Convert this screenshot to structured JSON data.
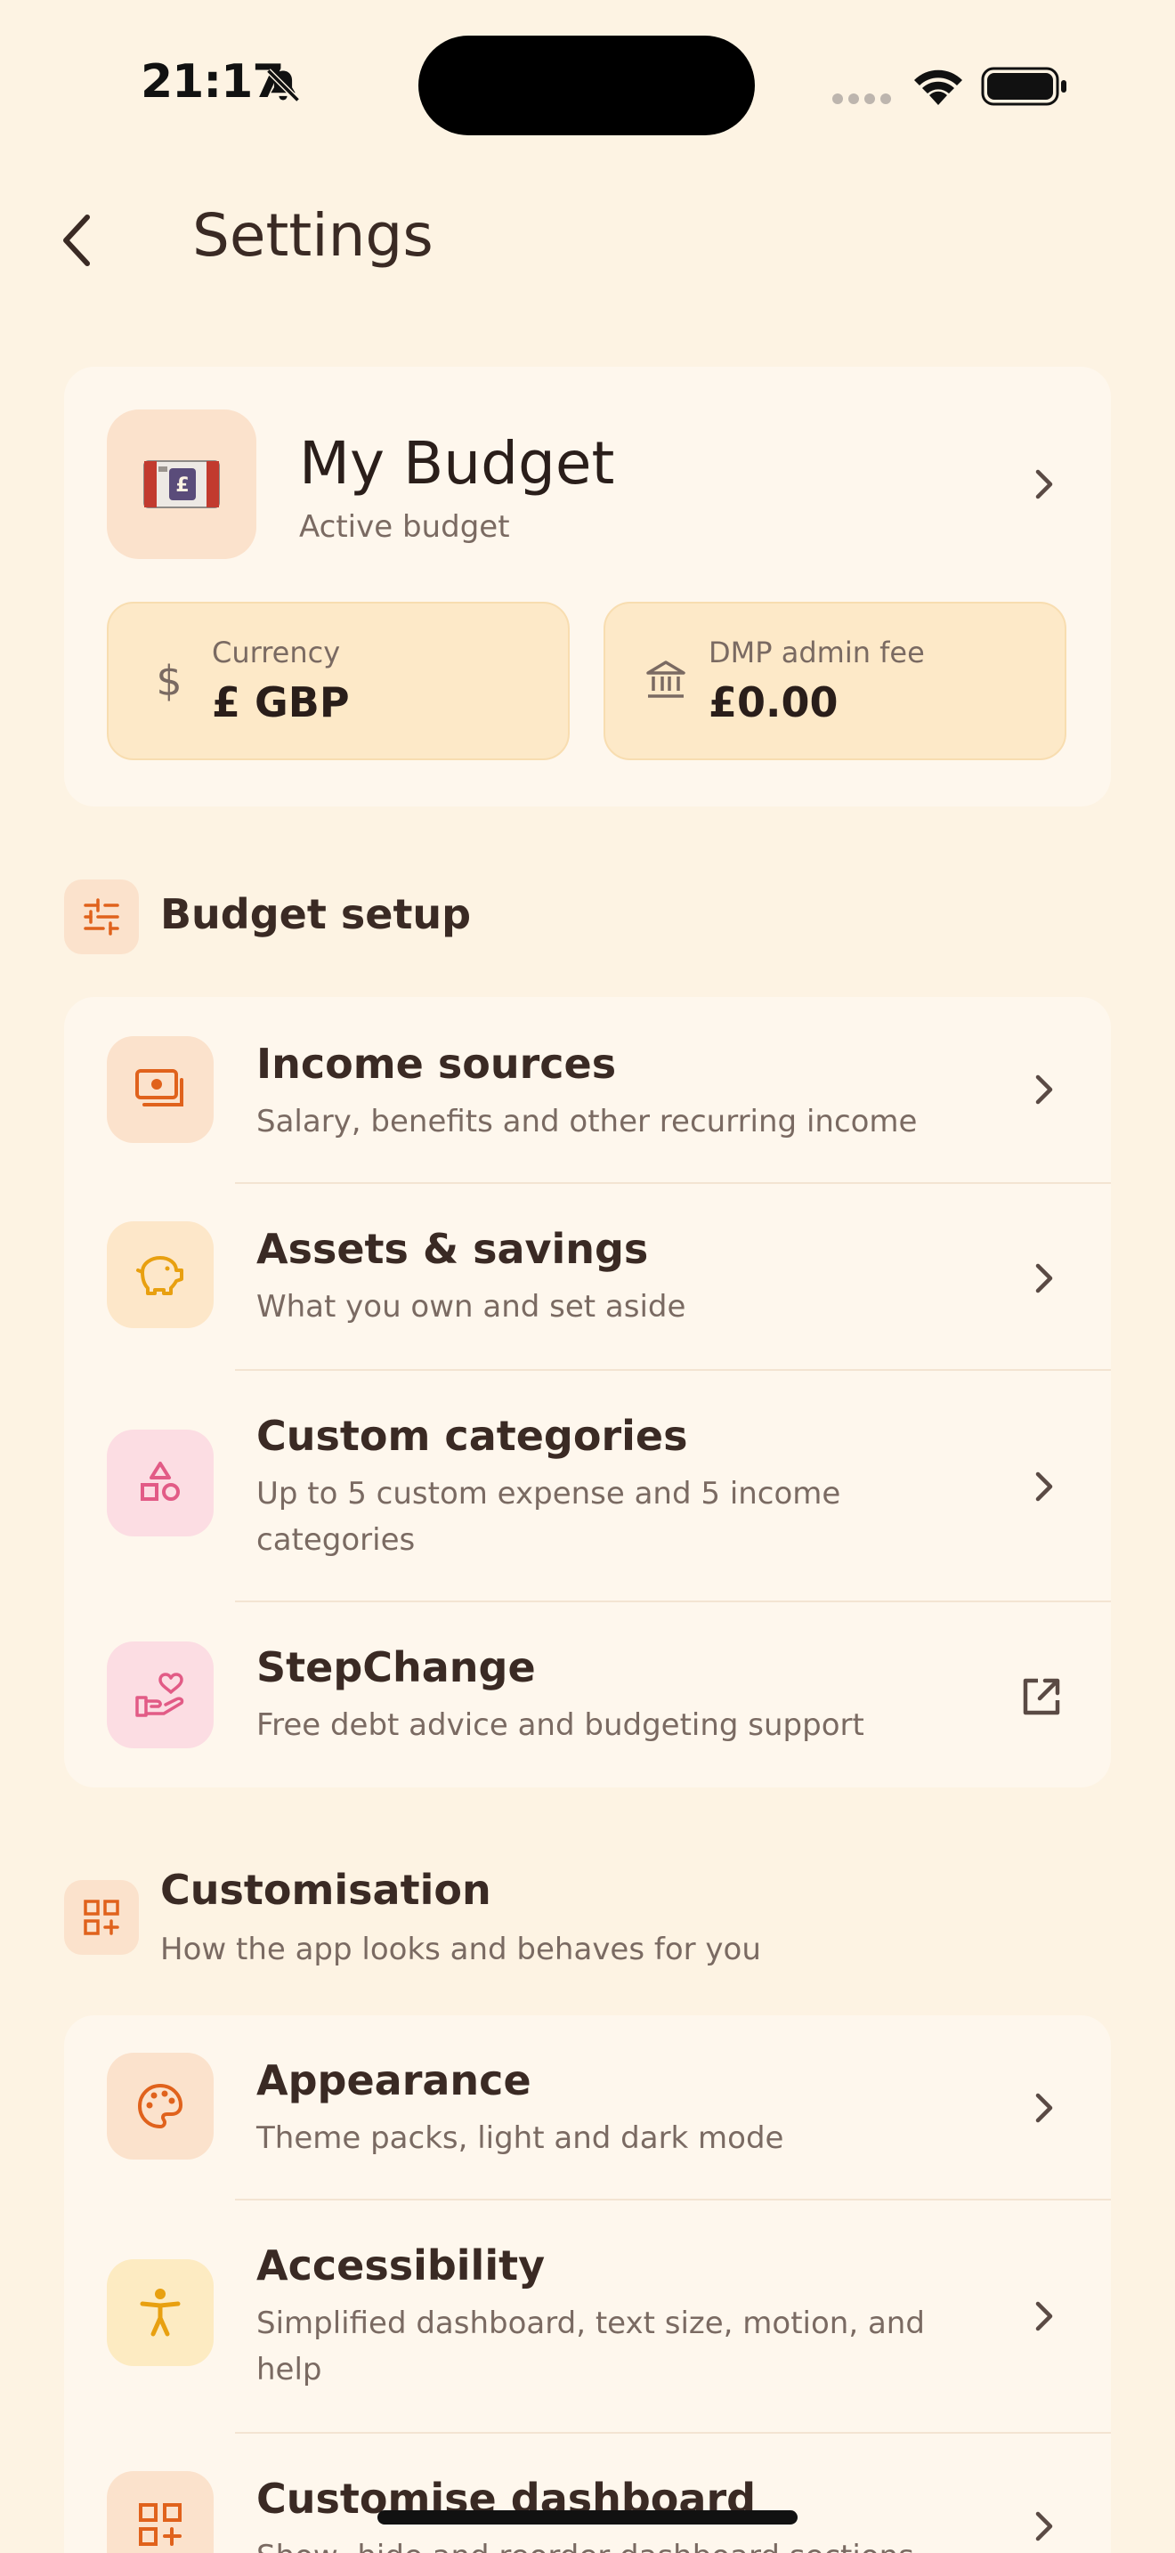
{
  "status_bar": {
    "time": "21:17"
  },
  "header": {
    "title": "Settings"
  },
  "budget": {
    "name": "My Budget",
    "subtitle": "Active budget",
    "currency_label": "Currency",
    "currency_value": "£ GBP",
    "fee_label": "DMP admin fee",
    "fee_value": "£0.00"
  },
  "budget_setup": {
    "title": "Budget setup",
    "items": [
      {
        "title": "Income sources",
        "subtitle": "Salary, benefits and other recurring income"
      },
      {
        "title": "Assets & savings",
        "subtitle": "What you own and set aside"
      },
      {
        "title": "Custom categories",
        "subtitle": "Up to 5 custom expense and 5 income categories"
      },
      {
        "title": "StepChange",
        "subtitle": "Free debt advice and budgeting support"
      }
    ]
  },
  "customisation": {
    "title": "Customisation",
    "subtitle": "How the app looks and behaves for you",
    "items": [
      {
        "title": "Appearance",
        "subtitle": "Theme packs, light and dark mode"
      },
      {
        "title": "Accessibility",
        "subtitle": "Simplified dashboard, text size, motion, and help"
      },
      {
        "title": "Customise dashboard",
        "subtitle": "Show, hide and reorder dashboard sections"
      }
    ]
  },
  "colors": {
    "background": "#FDF3E3",
    "card": "#FEF7ED",
    "accent_orange": "#E0621C",
    "accent_pink": "#E25B86",
    "accent_yellow": "#E8A010"
  }
}
